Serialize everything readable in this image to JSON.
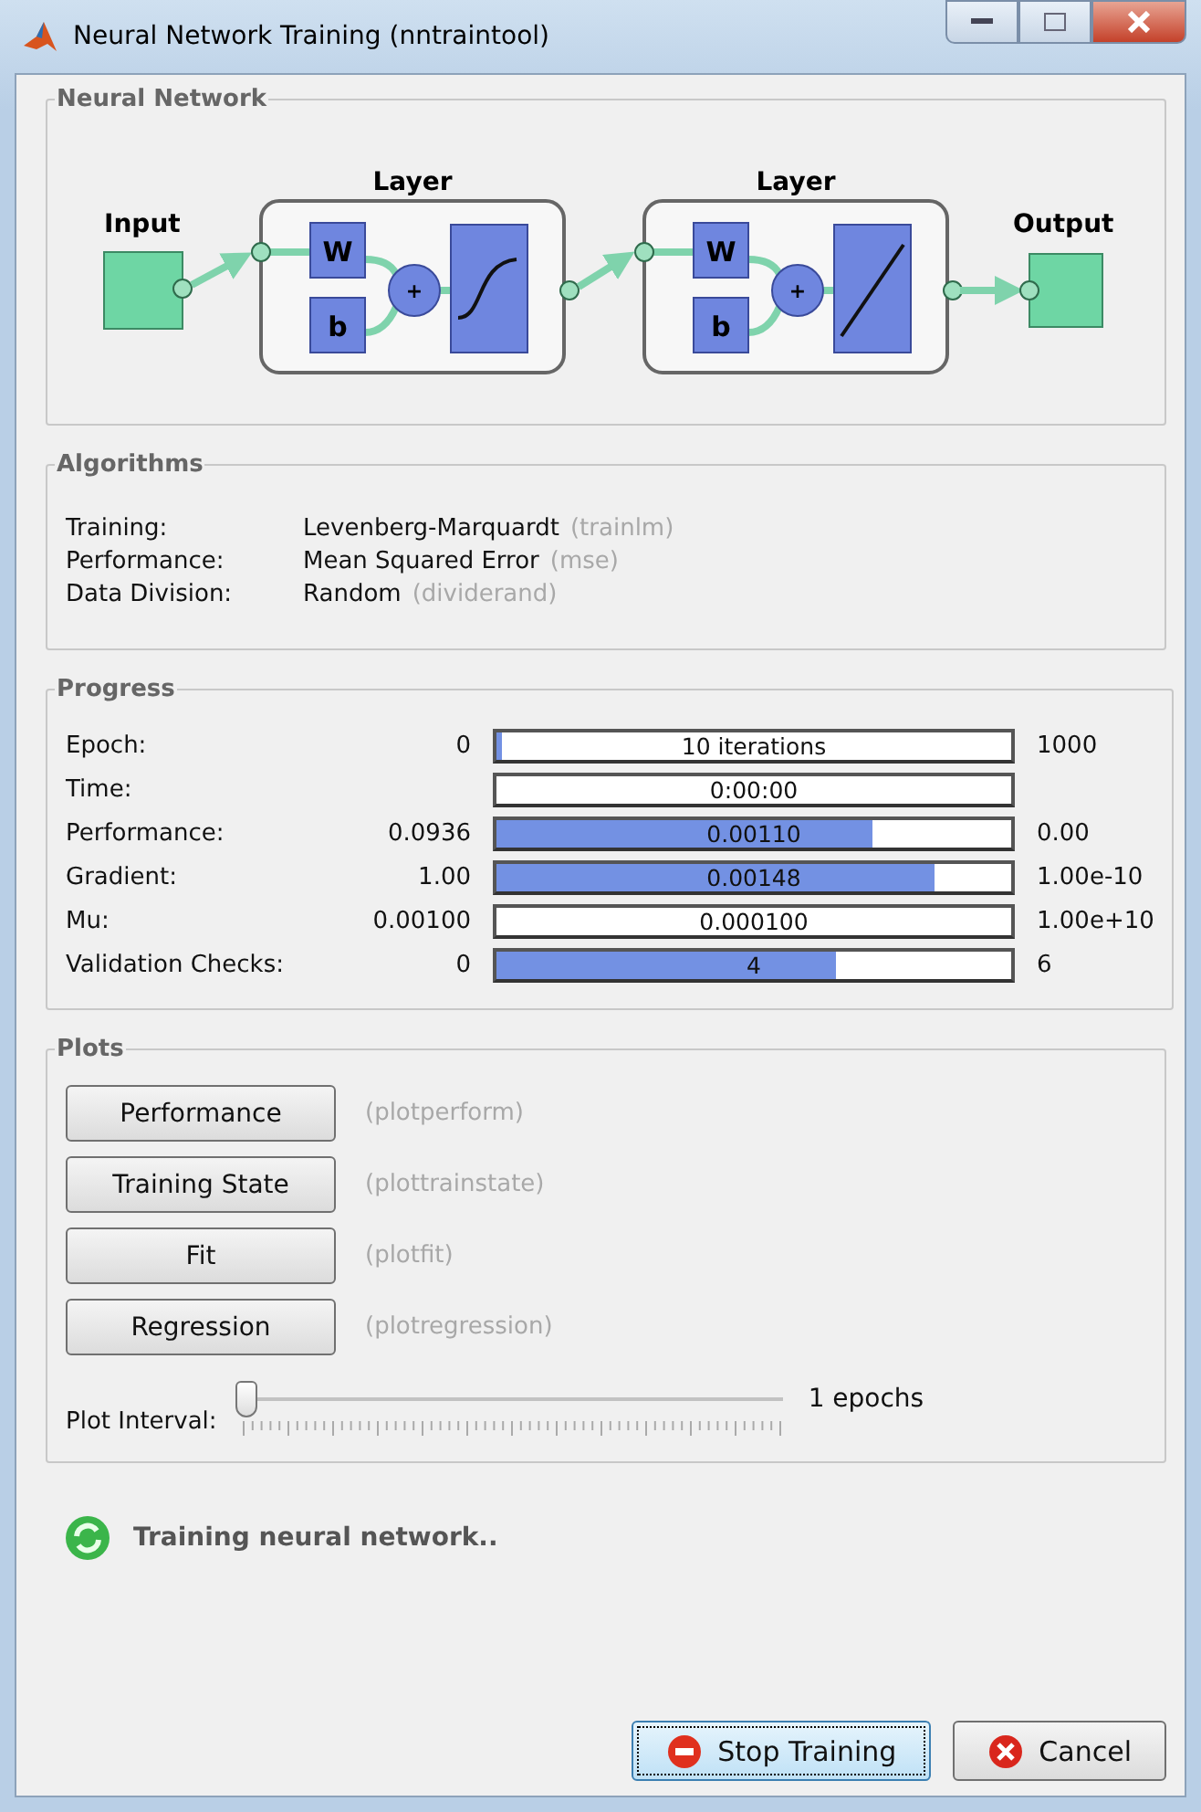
{
  "window": {
    "title": "Neural Network Training (nntraintool)"
  },
  "network": {
    "title": "Neural Network",
    "input_label": "Input",
    "output_label": "Output",
    "layers": [
      {
        "title": "Layer",
        "weight": "W",
        "bias": "b",
        "sum": "+",
        "kind": "sigmoid"
      },
      {
        "title": "Layer",
        "weight": "W",
        "bias": "b",
        "sum": "+",
        "kind": "linear"
      }
    ]
  },
  "algorithms": {
    "title": "Algorithms",
    "rows": [
      {
        "label": "Training:",
        "value": "Levenberg-Marquardt",
        "hint": "(trainlm)"
      },
      {
        "label": "Performance:",
        "value": "Mean Squared Error",
        "hint": "(mse)"
      },
      {
        "label": "Data Division:",
        "value": "Random",
        "hint": "(dividerand)"
      }
    ]
  },
  "progress": {
    "title": "Progress",
    "rows": [
      {
        "label": "Epoch:",
        "start": "0",
        "reading": "10 iterations",
        "level": 0.01,
        "end": "1000"
      },
      {
        "label": "Time:",
        "reading": "0:00:00"
      },
      {
        "label": "Performance:",
        "start": "0.0936",
        "reading": "0.00110",
        "level": 0.73,
        "end": "0.00"
      },
      {
        "label": "Gradient:",
        "start": "1.00",
        "reading": "0.00148",
        "level": 0.85,
        "end": "1.00e-10"
      },
      {
        "label": "Mu:",
        "start": "0.00100",
        "reading": "0.000100",
        "end": "1.00e+10"
      },
      {
        "label": "Validation Checks:",
        "start": "0",
        "reading": "4",
        "level": 0.66,
        "end": "6"
      }
    ]
  },
  "plots": {
    "title": "Plots",
    "buttons": [
      {
        "label": "Performance",
        "hint": "(plotperform)"
      },
      {
        "label": "Training State",
        "hint": "(plottrainstate)"
      },
      {
        "label": "Fit",
        "hint": "(plotfit)"
      },
      {
        "label": "Regression",
        "hint": "(plotregression)"
      }
    ],
    "interval": {
      "label": "Plot Interval:",
      "level": 0,
      "reading": "1 epochs"
    }
  },
  "status": {
    "text": "Training neural network.."
  },
  "buttons": [
    {
      "label": "Stop Training",
      "kind": "stop",
      "focused": true
    },
    {
      "label": "Cancel",
      "kind": "cancel",
      "focused": false
    }
  ]
}
